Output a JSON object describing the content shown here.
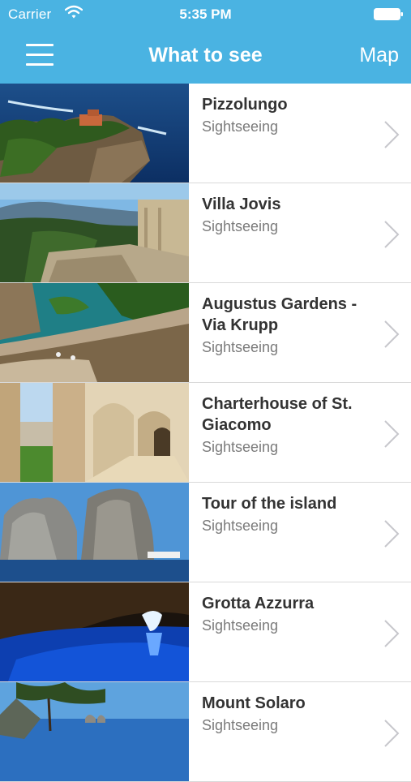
{
  "status_bar": {
    "carrier": "Carrier",
    "time": "5:35 PM"
  },
  "nav": {
    "title": "What to see",
    "map_label": "Map"
  },
  "colors": {
    "accent": "#4ab3e2",
    "title_text": "#333333",
    "subtitle_text": "#7a7a7a",
    "chevron": "#c7c7cc"
  },
  "items": [
    {
      "title": "Pizzolungo",
      "subtitle": "Sightseeing"
    },
    {
      "title": "Villa Jovis",
      "subtitle": "Sightseeing"
    },
    {
      "title": "Augustus Gardens - Via Krupp",
      "subtitle": "Sightseeing"
    },
    {
      "title": "Charterhouse of St. Giacomo",
      "subtitle": "Sightseeing"
    },
    {
      "title": "Tour of the island",
      "subtitle": "Sightseeing"
    },
    {
      "title": "Grotta Azzurra",
      "subtitle": "Sightseeing"
    },
    {
      "title": "Mount Solaro",
      "subtitle": "Sightseeing"
    }
  ]
}
